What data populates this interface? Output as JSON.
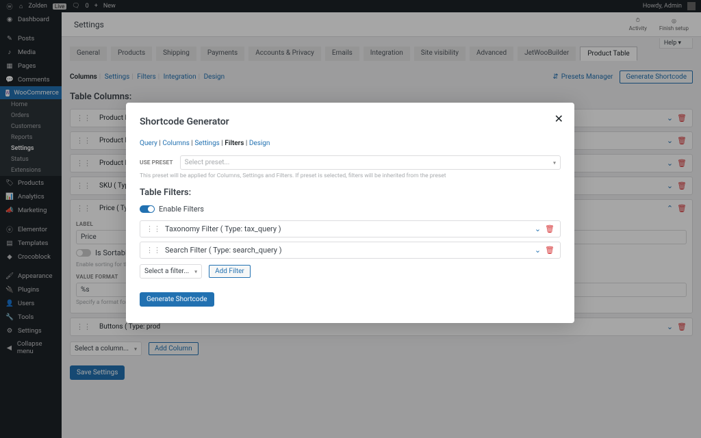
{
  "adminbar": {
    "site": "Zolden",
    "live": "Live",
    "comments": "0",
    "new": "New",
    "howdy": "Howdy, Admin"
  },
  "sidebar": {
    "items": [
      {
        "icon": "dashboard",
        "label": "Dashboard"
      },
      {
        "icon": "pin",
        "label": "Posts"
      },
      {
        "icon": "media",
        "label": "Media"
      },
      {
        "icon": "page",
        "label": "Pages"
      },
      {
        "icon": "comment",
        "label": "Comments"
      },
      {
        "icon": "woo",
        "label": "WooCommerce",
        "active": true
      },
      {
        "icon": "tag",
        "label": "Products"
      },
      {
        "icon": "chart",
        "label": "Analytics"
      },
      {
        "icon": "mega",
        "label": "Marketing"
      },
      {
        "icon": "elem",
        "label": "Elementor"
      },
      {
        "icon": "tmpl",
        "label": "Templates"
      },
      {
        "icon": "croco",
        "label": "Crocoblock"
      },
      {
        "icon": "brush",
        "label": "Appearance"
      },
      {
        "icon": "plug",
        "label": "Plugins"
      },
      {
        "icon": "user",
        "label": "Users"
      },
      {
        "icon": "tool",
        "label": "Tools"
      },
      {
        "icon": "settings",
        "label": "Settings"
      },
      {
        "icon": "collapse",
        "label": "Collapse menu"
      }
    ],
    "woo_sub": [
      "Home",
      "Orders",
      "Customers",
      "Reports",
      "Settings",
      "Status",
      "Extensions"
    ]
  },
  "header": {
    "title": "Settings",
    "activity": "Activity",
    "finish": "Finish setup",
    "help": "Help"
  },
  "settings_tabs": [
    "General",
    "Products",
    "Shipping",
    "Payments",
    "Accounts & Privacy",
    "Emails",
    "Integration",
    "Site visibility",
    "Advanced",
    "JetWooBuilder",
    "Product Table"
  ],
  "active_tab": 10,
  "page": {
    "subtabs": [
      "Columns",
      "Settings",
      "Filters",
      "Integration",
      "Design"
    ],
    "active_sub": 0,
    "presets_manager": "Presets Manager",
    "generate_shortcode": "Generate Shortcode",
    "section": "Table Columns:",
    "cols": [
      "Product ID ( Type: p",
      "Product Name ( Type",
      "Product Image ( Type",
      "SKU ( Type: product"
    ],
    "expanded": {
      "title": "Price ( Type: produc",
      "label_field": "LABEL",
      "label_value": "Price",
      "sortable": "Is Sortable",
      "sortable_hint": "Enable sorting for this co",
      "format_label": "VALUE FORMAT",
      "format_value": "%s",
      "format_hint": "Specify a format for the"
    },
    "last_col": "Buttons ( Type: prod",
    "select_column": "Select a column...",
    "add_column": "Add Column",
    "save": "Save Settings"
  },
  "modal": {
    "title": "Shortcode Generator",
    "tabs": [
      "Query",
      "Columns",
      "Settings",
      "Filters",
      "Design"
    ],
    "active": 3,
    "use_preset": "USE PRESET",
    "preset_placeholder": "Select preset...",
    "preset_hint": "This preset will be applied for Columns, Settings and Filters. If preset is selected, filters will be inherited from the preset",
    "section": "Table Filters:",
    "enable": "Enable Filters",
    "filters": [
      "Taxonomy Filter ( Type: tax_query )",
      "Search Filter ( Type: search_query )"
    ],
    "select_filter": "Select a filter...",
    "add_filter": "Add Filter",
    "generate": "Generate Shortcode"
  }
}
